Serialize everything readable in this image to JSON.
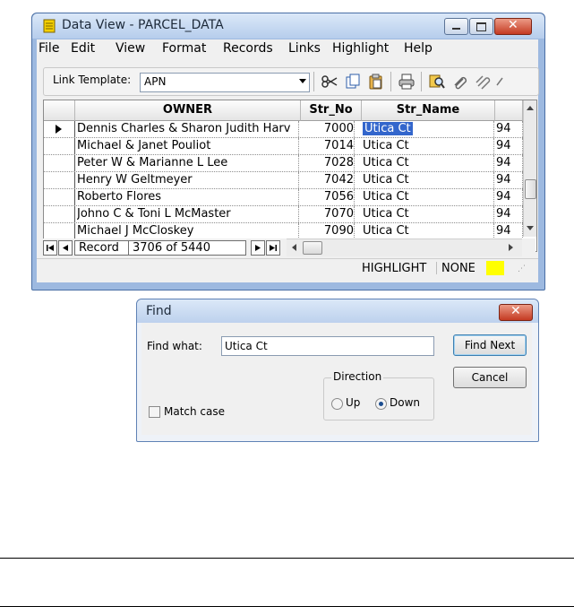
{
  "window": {
    "title": "Data View - PARCEL_DATA",
    "menu": [
      "File",
      "Edit",
      "View",
      "Format",
      "Records",
      "Links",
      "Highlight",
      "Help"
    ]
  },
  "toolbar": {
    "link_template_label": "Link Template:",
    "link_template_value": "APN"
  },
  "grid": {
    "columns": [
      "OWNER",
      "Str_No",
      "Str_Name"
    ],
    "rows": [
      {
        "owner": "Dennis Charles & Sharon Judith Harv",
        "str_no": "7000",
        "str_name": "Utica Ct",
        "extra": "94",
        "current": true
      },
      {
        "owner": "Michael & Janet Pouliot",
        "str_no": "7014",
        "str_name": "Utica Ct",
        "extra": "94"
      },
      {
        "owner": "Peter W & Marianne L Lee",
        "str_no": "7028",
        "str_name": "Utica Ct",
        "extra": "94"
      },
      {
        "owner": "Henry W Geltmeyer",
        "str_no": "7042",
        "str_name": "Utica Ct",
        "extra": "94"
      },
      {
        "owner": "Roberto Flores",
        "str_no": "7056",
        "str_name": "Utica Ct",
        "extra": "94"
      },
      {
        "owner": "Johno C & Toni L McMaster",
        "str_no": "7070",
        "str_name": "Utica Ct",
        "extra": "94"
      },
      {
        "owner": "Michael J McCloskey",
        "str_no": "7090",
        "str_name": "Utica Ct",
        "extra": "94"
      }
    ]
  },
  "navigation": {
    "record_label": "Record",
    "record_position": "3706 of 5440"
  },
  "status": {
    "highlight_label": "HIGHLIGHT",
    "highlight_value": "NONE",
    "highlight_color": "#ffff00"
  },
  "find_dialog": {
    "title": "Find",
    "find_what_label": "Find what:",
    "find_what_value": "Utica Ct",
    "find_next_label": "Find Next",
    "cancel_label": "Cancel",
    "direction_label": "Direction",
    "up_label": "Up",
    "down_label": "Down",
    "direction_selected": "Down",
    "match_case_label": "Match case",
    "match_case_checked": false
  },
  "colors": {
    "selection": "#3366cc",
    "window_frame": "#9db9e0",
    "close_button": "#c43a22"
  }
}
